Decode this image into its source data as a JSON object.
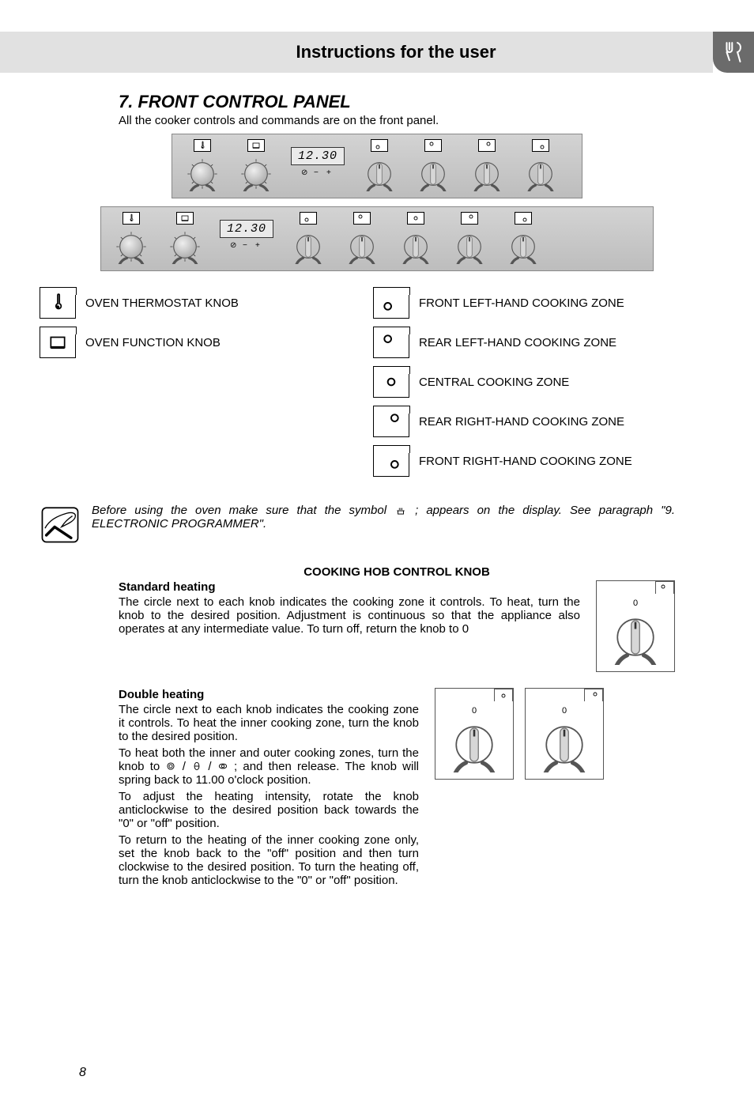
{
  "header": {
    "title": "Instructions for the user"
  },
  "section": {
    "heading": "7.  FRONT CONTROL PANEL",
    "intro": "All the cooker controls and commands are on the front panel."
  },
  "clock": "12.30",
  "legend": {
    "left": [
      {
        "label": "OVEN THERMOSTAT KNOB"
      },
      {
        "label": "OVEN FUNCTION KNOB"
      }
    ],
    "right": [
      {
        "label": "FRONT LEFT-HAND COOKING ZONE"
      },
      {
        "label": "REAR LEFT-HAND COOKING ZONE"
      },
      {
        "label": "CENTRAL COOKING ZONE"
      },
      {
        "label": "REAR RIGHT-HAND COOKING ZONE"
      },
      {
        "label": "FRONT RIGHT-HAND COOKING ZONE"
      }
    ]
  },
  "note": {
    "text_before": "Before using the oven make sure that the symbol ",
    "text_after": "; appears on the display. See paragraph \"9. ELECTRONIC PROGRAMMER\"."
  },
  "hob": {
    "heading": "COOKING HOB CONTROL KNOB",
    "standard_title": "Standard heating",
    "standard_body": "The circle next to each knob indicates the cooking zone it controls. To heat, turn the knob to the desired position. Adjustment is continuous so that the appliance also operates at any intermediate value. To turn off, return the knob to 0",
    "double_title": "Double heating",
    "double_p1": "The circle next to each knob indicates the cooking zone it controls. To heat the inner cooking zone, turn the knob to the desired position.",
    "double_p2a": "To heat both the inner and outer cooking zones, turn the knob to ",
    "double_p2b": "; and then release. The knob will spring back to 11.00 o'clock position.",
    "double_p3": "To adjust the heating intensity, rotate the knob anticlockwise to the desired position back towards the \"0\" or \"off\" position.",
    "double_p4": "To return to the heating of the inner cooking zone only, set the knob back to the \"off\" position and then turn clockwise to the desired position. To turn the heating off, turn the knob anticlockwise to the \"0\" or \"off\" position.",
    "knob_zero": "0"
  },
  "page_number": "8"
}
